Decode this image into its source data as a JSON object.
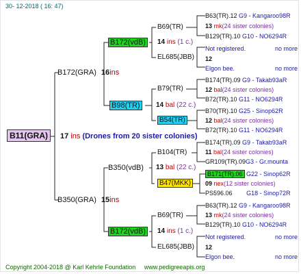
{
  "date": "30- 12-2018 ( 16: 47)",
  "footer": {
    "copyright": "Copyright 2004-2018 @ Karl Kehrle Foundation",
    "site": "www.pedigreeapis.org"
  },
  "root": {
    "name": "B11(GRA)",
    "num": "17",
    "ins": "ins",
    "note": "(Drones from 20 sister colonies)"
  },
  "p1": {
    "name": "B172(GRA)",
    "num": "16",
    "ins": "ins"
  },
  "p2": {
    "name": "B350(GRA)",
    "num": "15",
    "ins": "ins"
  },
  "g1": {
    "name": "B172(vdB)"
  },
  "g2": {
    "name": "B98(TR)",
    "num": "14",
    "mark": "bal",
    "note": "(22 c.)"
  },
  "g3": {
    "name": "B350(vdB)",
    "num": "13",
    "mark": "bal",
    "note": "(22 c.)"
  },
  "g4": {
    "name": "B172(vdB)"
  },
  "ggp": [
    {
      "name": "B69(TR)",
      "num": "14",
      "mark": "ins",
      "note": "(1 c.)"
    },
    {
      "name": "EL685(JBB)",
      "num": "12"
    },
    {
      "name": "B79(TR)"
    },
    {
      "name": "B54(TR)"
    },
    {
      "name": "B104(TR)",
      "num": "11",
      "mark": "bal",
      "note": "(22 c.)"
    },
    {
      "name": "B47(MKK)",
      "num": "09",
      "mark": "nex",
      "note": "(12 c.)"
    },
    {
      "name": "B69(TR)",
      "num": "14",
      "mark": "ins",
      "note": "(1 c.)"
    },
    {
      "name": "EL685(JBB)",
      "num": "12"
    }
  ],
  "right": [
    {
      "a": "B63(TR).12",
      "b": "G9 - Kangaroo98R"
    },
    {
      "n": "13",
      "m": "mk",
      "s": "(24 sister colonies)"
    },
    {
      "a": "B129(TR).10",
      "b": "G10 - NO6294R"
    },
    {
      "a": "Not registered.",
      "b": "no more"
    },
    {
      "n": "12"
    },
    {
      "a": "Elgon bee.",
      "b": "no more"
    },
    {
      "a": "B174(TR).09",
      "b": "G9 - Takab93aR"
    },
    {
      "n": "12",
      "m": "bal",
      "s": "(24 sister colonies)"
    },
    {
      "a": "B72(TR).10",
      "b": "G11 - NO6294R"
    },
    {
      "a": "B70(TR).10",
      "b": "G25 - Sinop62R"
    },
    {
      "n": "12",
      "m": "bal",
      "s": "(24 sister colonies)"
    },
    {
      "a": "B72(TR).10",
      "b": "G11 - NO6294R"
    },
    {
      "a": "B174(TR).09",
      "b": "G9 - Takab93aR"
    },
    {
      "n": "11",
      "m": "bal",
      "s": "(24 sister colonies)"
    },
    {
      "a": "GR109(TR).09",
      "b": "G3 - Gr.mounta"
    },
    {
      "a": "B171(TR).06",
      "b": "G22 - Sinop62R"
    },
    {
      "n": "09",
      "m": "nex",
      "s": "(12 sister colonies)"
    },
    {
      "a": "PS596.06",
      "b": "G18 - Sinop72R"
    },
    {
      "a": "B63(TR).12",
      "b": "G9 - Kangaroo98R"
    },
    {
      "n": "13",
      "m": "mk",
      "s": "(24 sister colonies)"
    },
    {
      "a": "B129(TR).10",
      "b": "G10 - NO6294R"
    },
    {
      "a": "Not registered.",
      "b": "no more"
    },
    {
      "n": "12"
    },
    {
      "a": "Elgon bee.",
      "b": "no more"
    }
  ]
}
